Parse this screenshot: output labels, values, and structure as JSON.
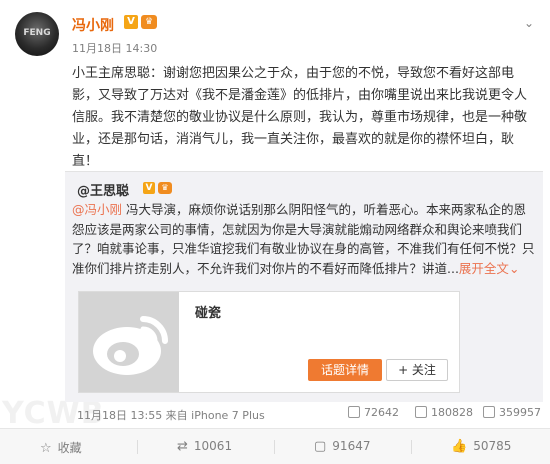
{
  "post": {
    "author": "冯小刚",
    "verified_badge": "V",
    "vip_badge": "♛",
    "timestamp": "11月18日 14:30",
    "text": "小王主席思聪：谢谢您把因果公之于众，由于您的不悦，导致您不看好这部电影，又导致了万达对《我不是潘金莲》的低排片，由你嘴里说出来比我说更令人信服。我不清楚您的敬业协议是什么原则，我认为，尊重市场规律，也是一种敬业，还是那句话，消消气儿，我一直关注你，最喜欢的就是你的襟怀坦白，耿直！"
  },
  "forward": {
    "author": "@王思聪",
    "verified_badge": "V",
    "vip_badge": "♛",
    "mention": "@冯小刚",
    "text": " 冯大导演，麻烦你说话别那么阴阳怪气的，听着恶心。本来两家私企的恩怨应该是两家公司的事情，怎就因为你是大导演就能煽动网络群众和舆论来喷我们了？咱就事论事，只准华谊挖我们有敬业协议在身的高管，不准我们有任何不悦？只准你们排片挤走别人，不允许我们对你片的不看好而降低排片？讲道...",
    "expand_label": "展开全文",
    "expand_arrow": "⌄",
    "link_card": {
      "title": "碰瓷",
      "topic_button": "话题详情",
      "follow_button": "+ 关注"
    },
    "meta": "11月18日 13:55 来自 iPhone 7 Plus",
    "stats": {
      "forwards": "72642",
      "comments": "180828",
      "likes": "359957"
    }
  },
  "actions": {
    "favorite": "收藏",
    "forward": "10061",
    "comment": "91647",
    "like": "50785"
  },
  "watermark": "YCWB"
}
